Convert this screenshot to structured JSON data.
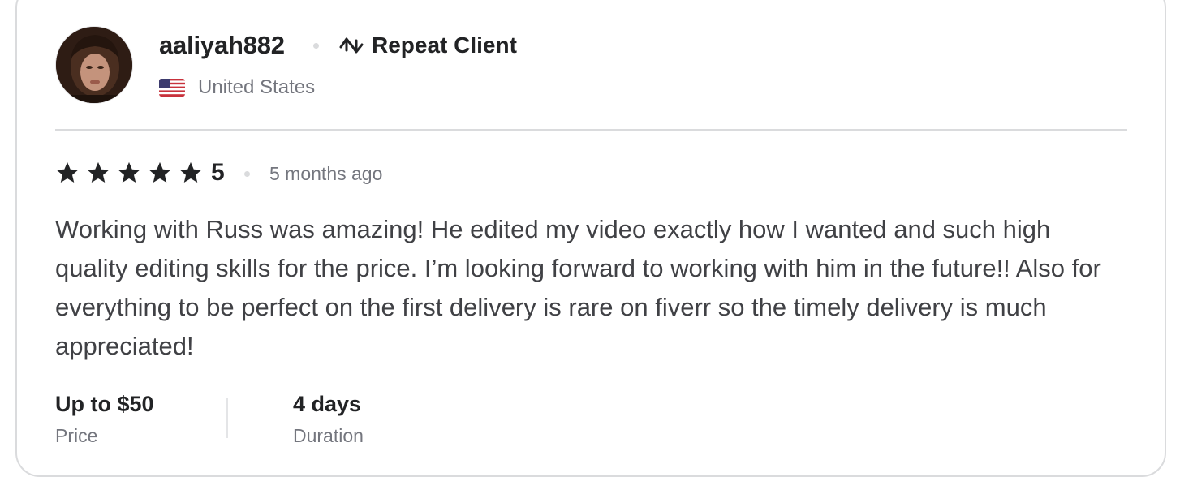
{
  "reviewer": {
    "username": "aaliyah882",
    "badge_label": "Repeat Client",
    "badge_icon": "repeat-arrows-icon",
    "country": "United States",
    "flag_icon": "us-flag-icon"
  },
  "rating": {
    "stars": 5,
    "value": "5",
    "time_ago": "5 months ago",
    "star_color": "#222325"
  },
  "review": {
    "text": "Working with Russ was amazing! He edited my video exactly how I wanted and such high quality editing skills for the price. I’m looking forward to working with him in the future!! Also for everything to be perfect on the first delivery is rare on fiverr so the timely delivery is much appreciated!"
  },
  "order_details": {
    "price_value": "Up to $50",
    "price_label": "Price",
    "duration_value": "4 days",
    "duration_label": "Duration"
  }
}
